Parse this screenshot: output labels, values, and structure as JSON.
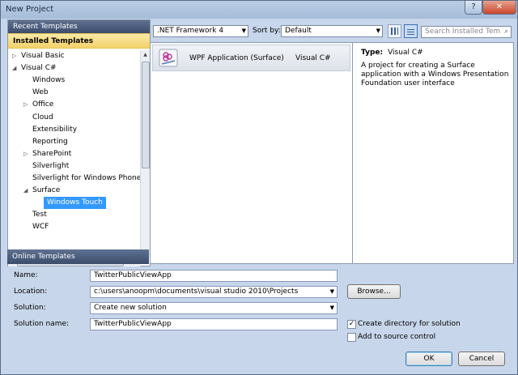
{
  "window": {
    "title": "New Project",
    "help_label": "?",
    "close_label": "✕"
  },
  "left": {
    "recent_templates": "Recent Templates",
    "installed_templates": "Installed Templates",
    "online_templates": "Online Templates",
    "tree": [
      {
        "label": "Visual Basic",
        "arrow": "▷"
      },
      {
        "label": "Visual C#",
        "arrow": "◢"
      },
      {
        "label": "Windows"
      },
      {
        "label": "Web"
      },
      {
        "label": "Office",
        "arrow": "▷"
      },
      {
        "label": "Cloud"
      },
      {
        "label": "Extensibility"
      },
      {
        "label": "Reporting"
      },
      {
        "label": "SharePoint",
        "arrow": "▷"
      },
      {
        "label": "Silverlight"
      },
      {
        "label": "Silverlight for Windows Phone"
      },
      {
        "label": "Surface",
        "arrow": "◢"
      },
      {
        "label": "Windows Touch",
        "selected": true
      },
      {
        "label": "Test"
      },
      {
        "label": "WCF"
      }
    ]
  },
  "toolbar": {
    "framework": ".NET Framework 4",
    "sort_by_label": "Sort by:",
    "sort_value": "Default",
    "search_placeholder": "Search Installed Tem"
  },
  "templates": [
    {
      "name": "WPF Application (Surface)",
      "language": "Visual C#"
    }
  ],
  "details": {
    "type_label": "Type:",
    "type_value": "Visual C#",
    "description": "A project for creating a Surface application with a Windows Presentation Foundation user interface"
  },
  "form": {
    "name_label": "Name:",
    "name_value": "TwitterPublicViewApp",
    "location_label": "Location:",
    "location_value": "c:\\users\\anoopm\\documents\\visual studio 2010\\Projects",
    "solution_label": "Solution:",
    "solution_value": "Create new solution",
    "solution_name_label": "Solution name:",
    "solution_name_value": "TwitterPublicViewApp",
    "browse_label": "Browse...",
    "create_directory_label": "Create directory for solution",
    "create_directory_checked": true,
    "add_source_control_label": "Add to source control",
    "add_source_control_checked": false
  },
  "buttons": {
    "ok": "OK",
    "cancel": "Cancel"
  }
}
